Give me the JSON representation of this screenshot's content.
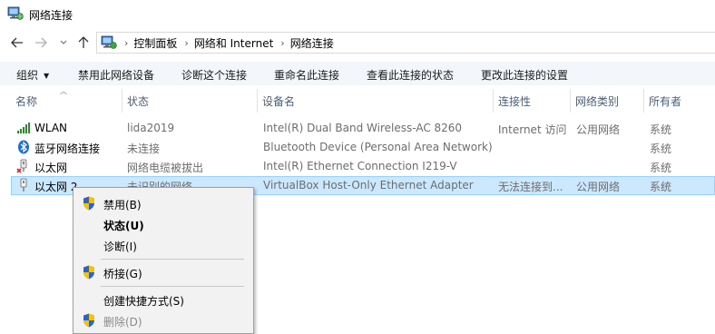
{
  "window": {
    "title": "网络连接"
  },
  "address": {
    "crumbs": [
      "控制面板",
      "网络和 Internet",
      "网络连接"
    ]
  },
  "commands": [
    "组织",
    "禁用此网络设备",
    "诊断这个连接",
    "重命名此连接",
    "查看此连接的状态",
    "更改此连接的设置"
  ],
  "columns": [
    "名称",
    "状态",
    "设备名",
    "连接性",
    "网络类别",
    "所有者"
  ],
  "rows": [
    {
      "name": "WLAN",
      "status": "lida2019",
      "device": "Intel(R) Dual Band Wireless-AC 8260",
      "connectivity": "Internet 访问",
      "category": "公用网络",
      "owner": "系统"
    },
    {
      "name": "蓝牙网络连接",
      "status": "未连接",
      "device": "Bluetooth Device (Personal Area Network)",
      "connectivity": "",
      "category": "",
      "owner": "系统"
    },
    {
      "name": "以太网",
      "status": "网络电缆被拔出",
      "device": "Intel(R) Ethernet Connection I219-V",
      "connectivity": "",
      "category": "",
      "owner": "系统"
    },
    {
      "name": "以太网 2",
      "status": "未识别的网络",
      "device": "VirtualBox Host-Only Ethernet Adapter",
      "connectivity": "无法连接到...",
      "category": "公用网络",
      "owner": "系统"
    }
  ],
  "context_menu": {
    "items": [
      {
        "label": "禁用(B)",
        "shield": true,
        "bold": false,
        "disabled": false
      },
      {
        "label": "状态(U)",
        "shield": false,
        "bold": true,
        "disabled": false
      },
      {
        "label": "诊断(I)",
        "shield": false,
        "bold": false,
        "disabled": false
      },
      {
        "label": "桥接(G)",
        "shield": true,
        "bold": false,
        "disabled": false
      },
      {
        "label": "创建快捷方式(S)",
        "shield": false,
        "bold": false,
        "disabled": false
      },
      {
        "label": "删除(D)",
        "shield": true,
        "bold": false,
        "disabled": true
      }
    ]
  },
  "colors": {
    "selection": "#cce8ff",
    "selection_border": "#99d1ff",
    "header_text": "#4c607a",
    "muted_text": "#6d6d6d"
  },
  "icons": [
    "network-connections-icon",
    "back-arrow-icon",
    "forward-arrow-icon",
    "recent-locations-icon",
    "up-arrow-icon",
    "wifi-signal-icon",
    "bluetooth-icon",
    "ethernet-disconnected-icon",
    "ethernet-icon",
    "uac-shield-icon"
  ]
}
